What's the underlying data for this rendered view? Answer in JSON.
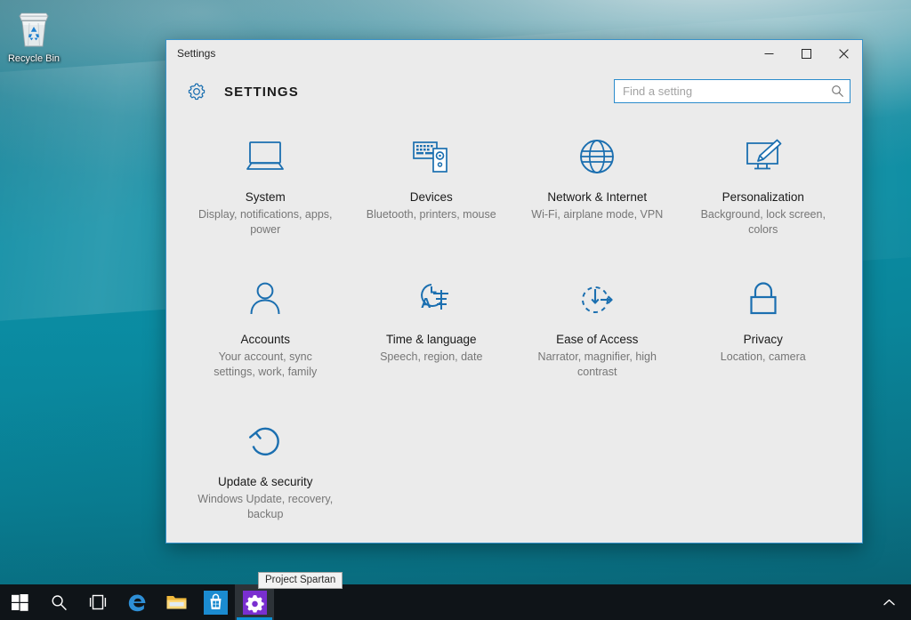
{
  "desktop": {
    "recycle_bin": {
      "label": "Recycle Bin",
      "icon": "recycle-bin-icon"
    },
    "wallpaper_colors": {
      "teal_mid": "#0a8ca2",
      "teal_deep": "#0b7082",
      "highlight": "#e2e9eb"
    }
  },
  "window": {
    "title": "Settings",
    "heading": "SETTINGS",
    "header_icon": "gear-icon",
    "accent_color": "#0078d7",
    "border_color": "#3a92c8",
    "background": "#ebebeb",
    "controls": {
      "minimize": "Minimize",
      "maximize": "Maximize",
      "close": "Close"
    },
    "search": {
      "placeholder": "Find a setting",
      "value": "",
      "icon": "search-icon"
    }
  },
  "tiles": [
    {
      "icon": "laptop-icon",
      "title": "System",
      "desc": "Display, notifications, apps, power"
    },
    {
      "icon": "keyboard-and-tower-icon",
      "title": "Devices",
      "desc": "Bluetooth, printers, mouse"
    },
    {
      "icon": "globe-icon",
      "title": "Network & Internet",
      "desc": "Wi-Fi, airplane mode, VPN"
    },
    {
      "icon": "monitor-paintbrush-icon",
      "title": "Personalization",
      "desc": "Background, lock screen, colors"
    },
    {
      "icon": "person-icon",
      "title": "Accounts",
      "desc": "Your account, sync settings, work, family"
    },
    {
      "icon": "clock-language-icon",
      "title": "Time & language",
      "desc": "Speech, region, date"
    },
    {
      "icon": "ease-of-access-clock-arrow-icon",
      "title": "Ease of Access",
      "desc": "Narrator, magnifier, high contrast"
    },
    {
      "icon": "padlock-icon",
      "title": "Privacy",
      "desc": "Location, camera"
    },
    {
      "icon": "refresh-circle-icon",
      "title": "Update & security",
      "desc": "Windows Update, recovery, backup"
    }
  ],
  "tooltip": {
    "text": "Project Spartan"
  },
  "taskbar": {
    "background": "#0f1418",
    "active_indicator_color": "#0b8fd4",
    "items": [
      {
        "name": "start-button",
        "icon": "windows-logo-icon",
        "label": "Start",
        "active": false
      },
      {
        "name": "search-button",
        "icon": "search-icon",
        "label": "Search",
        "active": false
      },
      {
        "name": "task-view-button",
        "icon": "task-view-icon",
        "label": "Task View",
        "active": false
      },
      {
        "name": "edge-button",
        "icon": "edge-icon",
        "label": "Project Spartan",
        "active": false
      },
      {
        "name": "file-explorer-button",
        "icon": "folder-icon",
        "label": "File Explorer",
        "active": false
      },
      {
        "name": "store-button",
        "icon": "store-bag-icon",
        "label": "Store",
        "active": false
      },
      {
        "name": "settings-taskbar-button",
        "icon": "gear-icon",
        "label": "Settings",
        "active": true
      }
    ],
    "tray": {
      "chevron": "chevron-up-icon"
    }
  }
}
